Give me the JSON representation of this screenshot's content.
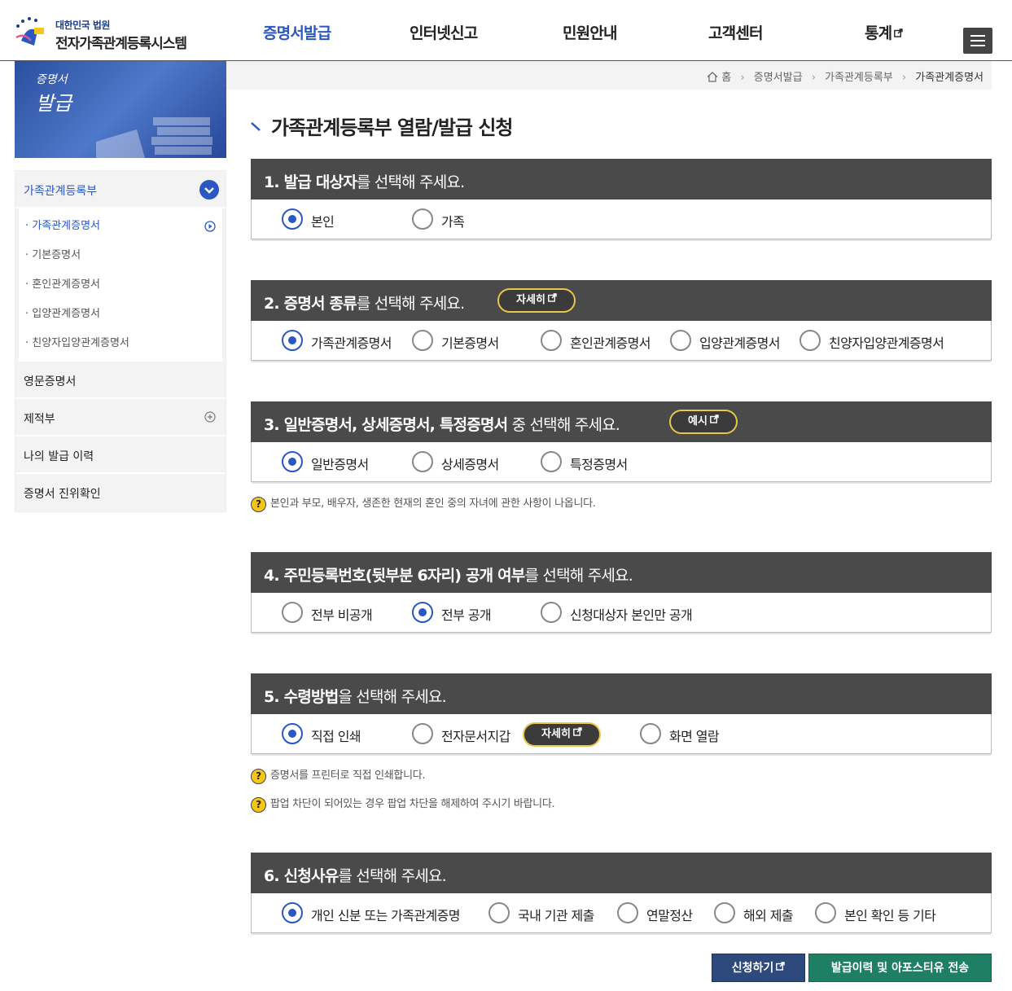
{
  "header": {
    "logo_sub": "대한민국 법원",
    "logo_title": "전자가족관계등록시스템",
    "nav": [
      {
        "label": "증명서발급"
      },
      {
        "label": "인터넷신고"
      },
      {
        "label": "민원안내"
      },
      {
        "label": "고객센터"
      },
      {
        "label": "통계"
      }
    ]
  },
  "sidebar": {
    "banner_line1": "증명서",
    "banner_line2": "발급",
    "group_open": "가족관계등록부",
    "sub_items": [
      {
        "label": "가족관계증명서"
      },
      {
        "label": "기본증명서"
      },
      {
        "label": "혼인관계증명서"
      },
      {
        "label": "입양관계증명서"
      },
      {
        "label": "친양자입양관계증명서"
      }
    ],
    "groups": [
      {
        "label": "영문증명서"
      },
      {
        "label": "제적부"
      },
      {
        "label": "나의 발급 이력"
      },
      {
        "label": "증명서 진위확인"
      }
    ]
  },
  "breadcrumb": {
    "home": "홈",
    "items": [
      "증명서발급",
      "가족관계등록부",
      "가족관계증명서"
    ]
  },
  "page_title": "가족관계등록부 열람/발급 신청",
  "steps": [
    {
      "bold": "1. 발급 대상자",
      "rest": "를 선택해 주세요.",
      "options": [
        "본인",
        "가족"
      ],
      "selected": "본인"
    },
    {
      "bold": "2. 증명서 종류",
      "rest": "를 선택해 주세요.",
      "pill": "자세히",
      "options": [
        "가족관계증명서",
        "기본증명서",
        "혼인관계증명서",
        "입양관계증명서",
        "친양자입양관계증명서"
      ],
      "selected": "가족관계증명서"
    },
    {
      "bold": "3. 일반증명서, 상세증명서, 특정증명서",
      "rest": " 중 선택해 주세요.",
      "pill": "예시",
      "options": [
        "일반증명서",
        "상세증명서",
        "특정증명서"
      ],
      "selected": "일반증명서"
    },
    {
      "bold": "4. 주민등록번호(뒷부분 6자리) 공개 여부",
      "rest": "를 선택해 주세요.",
      "options": [
        "전부 비공개",
        "전부 공개",
        "신청대상자 본인만 공개"
      ],
      "selected": "전부 공개"
    },
    {
      "bold": "5. 수령방법",
      "rest": "을 선택해 주세요.",
      "inline_pill": "자세히",
      "options": [
        "직접 인쇄",
        "전자문서지갑",
        "화면 열람"
      ],
      "selected": "직접 인쇄"
    },
    {
      "bold": "6. 신청사유",
      "rest": "를 선택해 주세요.",
      "options": [
        "개인 신분 또는 가족관계증명",
        "국내 기관 제출",
        "연말정산",
        "해외 제출",
        "본인 확인 등 기타"
      ],
      "selected": "개인 신분 또는 가족관계증명"
    }
  ],
  "notes": {
    "step3": "본인과 부모, 배우자, 생존한 현재의 혼인 중의 자녀에 관한 사항이 나옵니다.",
    "step5_a": "증명서를 프린터로 직접 인쇄합니다.",
    "step5_b": "팝업 차단이 되어있는 경우 팝업 차단을 해제하여 주시기 바랍니다."
  },
  "buttons": {
    "apply": "신청하기",
    "history": "발급이력 및 아포스티유 전송"
  },
  "colors": {
    "primary": "#2a57c2",
    "header_bar": "#4a4a4a",
    "apply": "#2e4a7d",
    "history": "#1e7f64",
    "pill_border": "#e7c64a"
  }
}
